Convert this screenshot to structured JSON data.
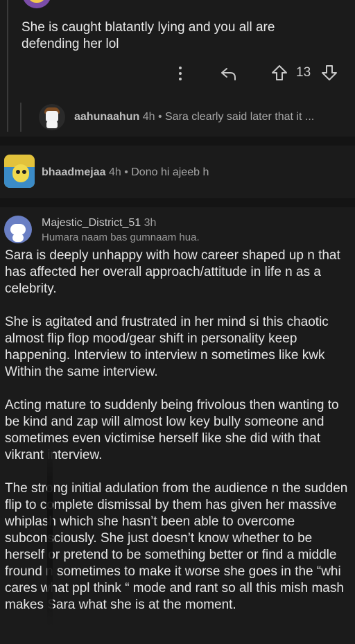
{
  "comment1": {
    "text": "She is caught blatantly lying and you all are defending her lol",
    "votes": "13",
    "reply": {
      "user": "aahunaahun",
      "time": "4h",
      "preview": "Sara clearly said later that it ..."
    }
  },
  "comment2": {
    "user": "bhaadmejaa",
    "time": "4h",
    "text": "Dono hi ajeeb h"
  },
  "comment3": {
    "user": "Majestic_District_51",
    "time": "3h",
    "flair": "Humara naam bas gumnaam hua.",
    "paragraphs": [
      "Sara is deeply unhappy with how career shaped up n that has affected her overall approach/attitude in life n as a celebrity.",
      "She is agitated and frustrated in her mind si this chaotic almost flip flop mood/gear shift in personality keep happening. Interview to interview n sometimes like kwk Within the same interview.",
      "Acting mature to suddenly being frivolous then wanting to be kind and zap will almost low key bully someone and sometimes even victimise herself like she did with that vikrant interview.",
      "The strong initial adulation from the audience n the sudden flip to complete dismissal by them has given her massive whiplash which she hasn’t been able to overcome subconsciously. She just doesn’t know whether to be herself or pretend to be something better or find a middle fround n sometimes to make it worse she goes in the “whi cares what ppl think “ mode and rant so all this mish mash makes Sara what she is at the moment."
    ]
  },
  "separator": "•",
  "icons": {
    "menu": "more-vertical-icon",
    "reply": "reply-icon",
    "upvote": "upvote-icon",
    "downvote": "downvote-icon"
  }
}
